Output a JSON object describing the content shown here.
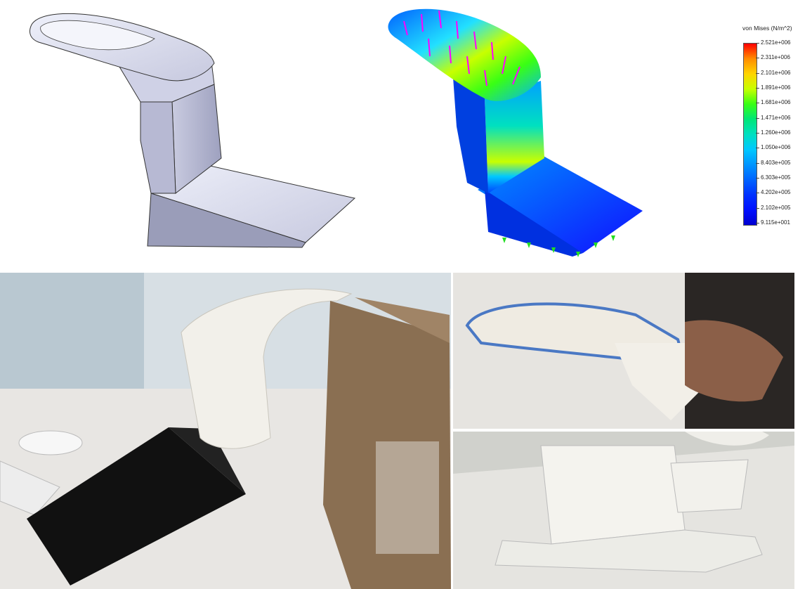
{
  "legend": {
    "title": "von Mises (N/m^2)",
    "labels": [
      "2.521e+006",
      "2.311e+006",
      "2.101e+006",
      "1.891e+006",
      "1.681e+006",
      "1.471e+006",
      "1.260e+006",
      "1.050e+006",
      "8.403e+005",
      "6.303e+005",
      "4.202e+005",
      "2.102e+005",
      "9.115e+001"
    ],
    "colors": [
      "#ff0000",
      "#ff8c00",
      "#ffd400",
      "#c8ff00",
      "#39ff14",
      "#00e676",
      "#00e0c0",
      "#00c8ff",
      "#0096ff",
      "#0064ff",
      "#0032ff",
      "#0010ff",
      "#0000d0"
    ]
  }
}
